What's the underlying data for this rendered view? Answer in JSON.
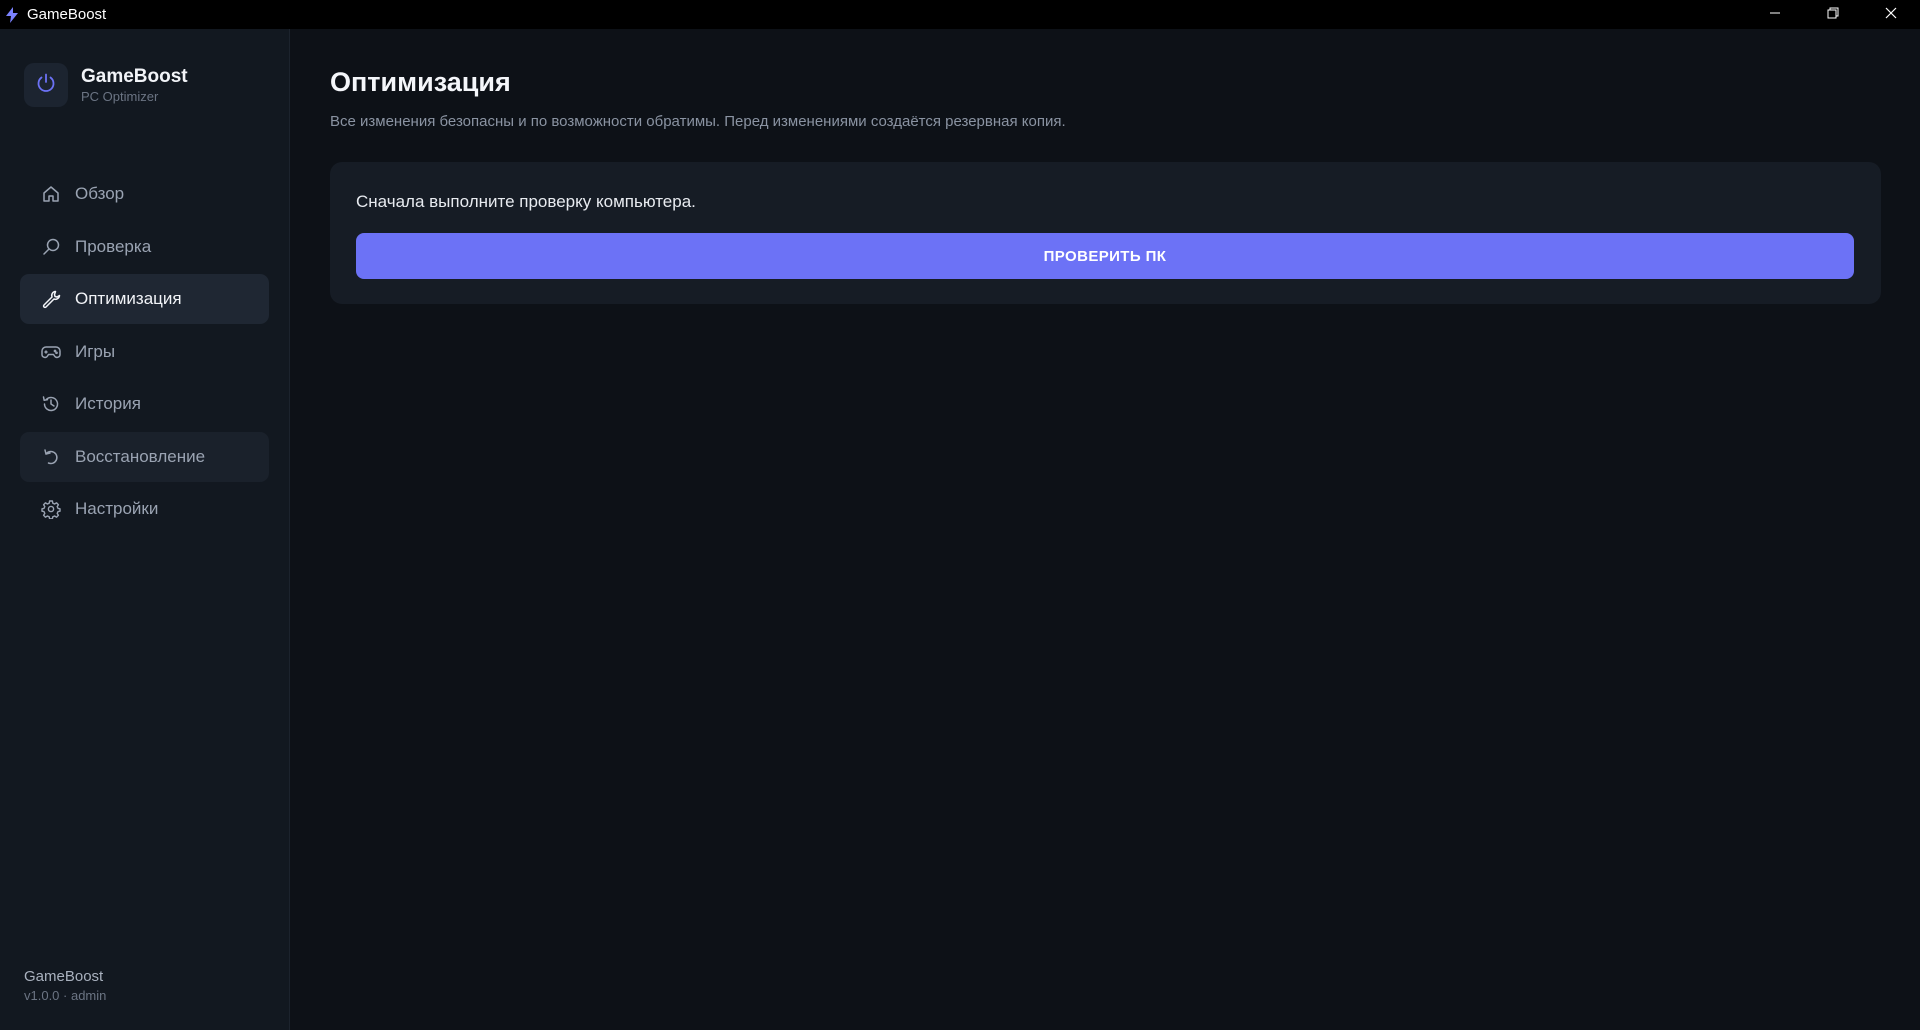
{
  "window": {
    "title": "GameBoost",
    "controls": {
      "minimize": "minimize-icon",
      "restore": "restore-icon",
      "close": "close-icon"
    }
  },
  "sidebar": {
    "brand": {
      "name": "GameBoost",
      "subtitle": "PC Optimizer",
      "icon": "power-icon"
    },
    "items": [
      {
        "label": "Обзор",
        "icon": "home-icon",
        "state": "normal"
      },
      {
        "label": "Проверка",
        "icon": "search-icon",
        "state": "normal"
      },
      {
        "label": "Оптимизация",
        "icon": "wrench-icon",
        "state": "active"
      },
      {
        "label": "Игры",
        "icon": "gamepad-icon",
        "state": "normal"
      },
      {
        "label": "История",
        "icon": "history-icon",
        "state": "normal"
      },
      {
        "label": "Восстановление",
        "icon": "undo-icon",
        "state": "hovered"
      },
      {
        "label": "Настройки",
        "icon": "gear-icon",
        "state": "normal"
      }
    ],
    "footer": {
      "app_name": "GameBoost",
      "version": "v1.0.0 · admin"
    }
  },
  "main": {
    "title": "Оптимизация",
    "subtitle": "Все изменения безопасны и по возможности обратимы. Перед изменениями создаётся резервная копия.",
    "card": {
      "message": "Сначала выполните проверку компьютера.",
      "button_label": "ПРОВЕРИТЬ ПК"
    }
  },
  "colors": {
    "accent": "#6c72f6",
    "background": "#0d1117",
    "sidebar": "#121820",
    "card": "#161c25",
    "active_item": "#1f2733"
  }
}
